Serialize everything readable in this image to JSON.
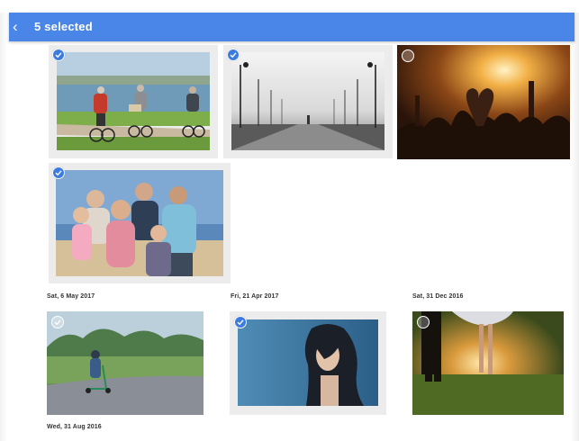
{
  "appbar": {
    "back_icon": "arrow-back-icon",
    "selection_title": "5 selected",
    "color": "#4a86e8"
  },
  "photos": [
    {
      "id": "cyclists",
      "subject": "Elderly people cycling by the lake",
      "selected": true
    },
    {
      "id": "pier",
      "subject": "Black and white pier with lamps",
      "selected": true
    },
    {
      "id": "concert",
      "subject": "Concert crowd making heart hands",
      "selected": false
    },
    {
      "id": "family",
      "subject": "Family group portrait at the beach",
      "selected": true
    },
    {
      "id": "scooter",
      "subject": "Boy riding scooter in park",
      "selected": false
    },
    {
      "id": "woman",
      "subject": "Woman with windswept hair",
      "selected": true
    },
    {
      "id": "couple",
      "subject": "Couple silhouette at sunset",
      "selected": false
    }
  ],
  "dates": {
    "group1": "Sat, 6 May 2017",
    "group2": "Fri, 21 Apr 2017",
    "group3": "Sat, 31 Dec 2016",
    "group4": "Wed, 31 Aug 2016"
  },
  "colors": {
    "check_selected": "#3c7ce0",
    "tile_frame": "#ececec"
  }
}
